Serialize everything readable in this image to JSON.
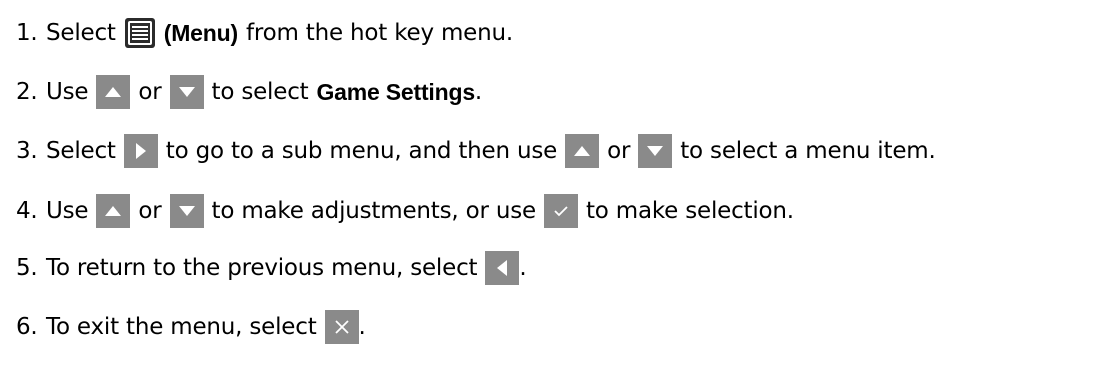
{
  "steps": [
    {
      "number": "1.",
      "parts": [
        "Select",
        "(Menu)",
        "from the hot key menu."
      ]
    },
    {
      "number": "2.",
      "parts": [
        "Use",
        "or",
        "to select",
        "Game Settings",
        "."
      ]
    },
    {
      "number": "3.",
      "parts": [
        "Select",
        "to go to a sub menu, and then use",
        "or",
        "to select a menu item."
      ]
    },
    {
      "number": "4.",
      "parts": [
        "Use",
        "or",
        "to make adjustments, or use",
        "to make selection."
      ]
    },
    {
      "number": "5.",
      "parts": [
        "To return to the previous menu, select",
        "."
      ]
    },
    {
      "number": "6.",
      "parts": [
        "To exit the menu, select",
        "."
      ]
    }
  ],
  "icons": {
    "menu": "menu-icon",
    "up": "up-arrow-icon",
    "down": "down-arrow-icon",
    "right": "right-arrow-icon",
    "left": "left-arrow-icon",
    "ok": "checkmark-icon",
    "exit": "close-icon"
  },
  "colors": {
    "key_background": "#8a8a8a",
    "key_glyph": "#ffffff",
    "text": "#000000"
  }
}
